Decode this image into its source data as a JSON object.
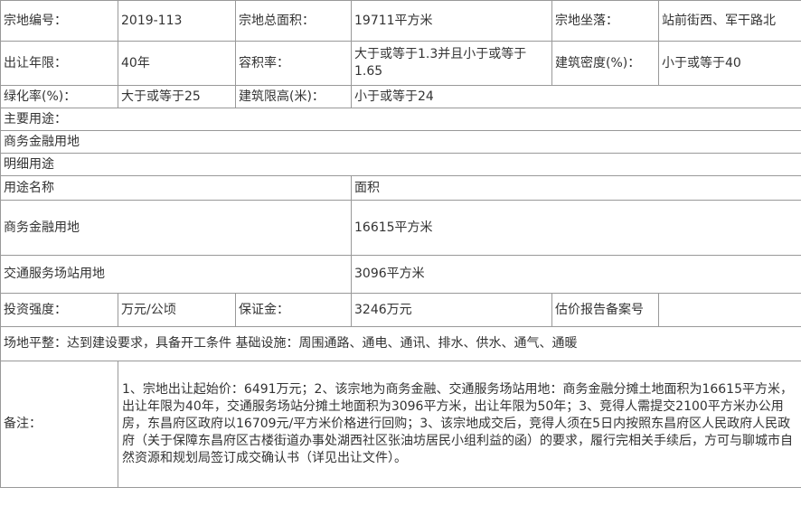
{
  "rows": {
    "r1": [
      "宗地编号：",
      "2019-113",
      "宗地总面积：",
      "19711平方米",
      "宗地坐落：",
      "站前街西、军干路北"
    ],
    "r2": [
      "出让年限：",
      "40年",
      "容积率：",
      "大于或等于1.3并且小于或等于1.65",
      "建筑密度(%)：",
      "小于或等于40"
    ],
    "r3": [
      "绿化率(%)：",
      "大于或等于25",
      "建筑限高(米)：",
      "小于或等于24"
    ],
    "main_use_label": "主要用途：",
    "main_use_value": "商务金融用地",
    "detail_use_label": "明细用途",
    "use_header": [
      "用途名称",
      "面积"
    ],
    "uses": [
      [
        "商务金融用地",
        "16615平方米"
      ],
      [
        "交通服务场站用地",
        "3096平方米"
      ]
    ],
    "r_invest": [
      "投资强度：",
      "万元/公顷",
      "保证金：",
      "3246万元",
      "估价报告备案号",
      ""
    ],
    "site": "场地平整：达到建设要求，具备开工条件 基础设施：周围通路、通电、通讯、排水、供水、通气、通暖",
    "remark_label": "备注：",
    "remark_text": "1、宗地出让起始价：6491万元；2、该宗地为商务金融、交通服务场站用地：商务金融分摊土地面积为16615平方米，出让年限为40年，交通服务场站分摊土地面积为3096平方米，出让年限为50年；3、竞得人需提交2100平方米办公用房，东昌府区政府以16709元/平方米价格进行回购；3、该宗地成交后，竞得人须在5日内按照东昌府区人民政府人民政府（关于保障东昌府区古楼街道办事处湖西社区张油坊居民小组利益的函）的要求，履行完相关手续后，方可与聊城市自然资源和规划局签订成交确认书（详见出让文件）。"
  }
}
